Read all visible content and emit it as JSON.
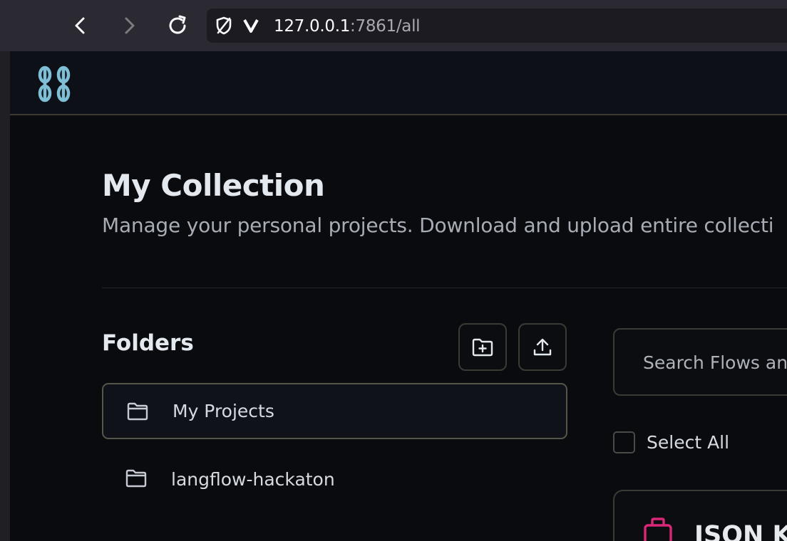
{
  "browser": {
    "url_host": "127.0.0.1",
    "url_path": ":7861/all"
  },
  "app": {
    "logo_icon": "chain-link-icon"
  },
  "page": {
    "title": "My Collection",
    "subtitle": "Manage your personal projects. Download and upload entire collecti"
  },
  "folders": {
    "heading": "Folders",
    "actions": [
      {
        "icon": "folder-plus-icon"
      },
      {
        "icon": "upload-icon"
      }
    ],
    "items": [
      {
        "label": "My Projects",
        "selected": true
      },
      {
        "label": "langflow-hackaton",
        "selected": false
      }
    ]
  },
  "flows": {
    "search_placeholder": "Search Flows and",
    "select_all_label": "Select All",
    "cards": [
      {
        "title": "JSON K",
        "icon": "briefcase-icon",
        "icon_color": "#db2777"
      }
    ]
  }
}
